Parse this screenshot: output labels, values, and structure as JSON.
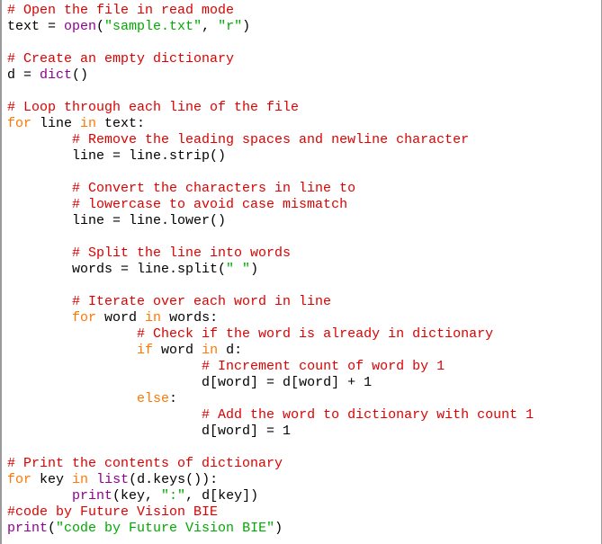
{
  "editor": {
    "indent_unit": "        ",
    "lines": [
      [
        {
          "t": "comment",
          "v": "# Open the file in read mode"
        }
      ],
      [
        {
          "t": "plain",
          "v": "text = "
        },
        {
          "t": "builtin",
          "v": "open"
        },
        {
          "t": "plain",
          "v": "("
        },
        {
          "t": "string",
          "v": "\"sample.txt\""
        },
        {
          "t": "plain",
          "v": ", "
        },
        {
          "t": "string",
          "v": "\"r\""
        },
        {
          "t": "plain",
          "v": ")"
        }
      ],
      [],
      [
        {
          "t": "comment",
          "v": "# Create an empty dictionary"
        }
      ],
      [
        {
          "t": "plain",
          "v": "d = "
        },
        {
          "t": "builtin",
          "v": "dict"
        },
        {
          "t": "plain",
          "v": "()"
        }
      ],
      [],
      [
        {
          "t": "comment",
          "v": "# Loop through each line of the file"
        }
      ],
      [
        {
          "t": "keyword",
          "v": "for"
        },
        {
          "t": "plain",
          "v": " line "
        },
        {
          "t": "keyword",
          "v": "in"
        },
        {
          "t": "plain",
          "v": " text:"
        }
      ],
      [
        {
          "t": "indent",
          "n": 1
        },
        {
          "t": "comment",
          "v": "# Remove the leading spaces and newline character"
        }
      ],
      [
        {
          "t": "indent",
          "n": 1
        },
        {
          "t": "plain",
          "v": "line = line.strip()"
        }
      ],
      [],
      [
        {
          "t": "indent",
          "n": 1
        },
        {
          "t": "comment",
          "v": "# Convert the characters in line to"
        }
      ],
      [
        {
          "t": "indent",
          "n": 1
        },
        {
          "t": "comment",
          "v": "# lowercase to avoid case mismatch"
        }
      ],
      [
        {
          "t": "indent",
          "n": 1
        },
        {
          "t": "plain",
          "v": "line = line.lower()"
        }
      ],
      [],
      [
        {
          "t": "indent",
          "n": 1
        },
        {
          "t": "comment",
          "v": "# Split the line into words"
        }
      ],
      [
        {
          "t": "indent",
          "n": 1
        },
        {
          "t": "plain",
          "v": "words = line.split("
        },
        {
          "t": "string",
          "v": "\" \""
        },
        {
          "t": "plain",
          "v": ")"
        }
      ],
      [],
      [
        {
          "t": "indent",
          "n": 1
        },
        {
          "t": "comment",
          "v": "# Iterate over each word in line"
        }
      ],
      [
        {
          "t": "indent",
          "n": 1
        },
        {
          "t": "keyword",
          "v": "for"
        },
        {
          "t": "plain",
          "v": " word "
        },
        {
          "t": "keyword",
          "v": "in"
        },
        {
          "t": "plain",
          "v": " words:"
        }
      ],
      [
        {
          "t": "indent",
          "n": 2
        },
        {
          "t": "comment",
          "v": "# Check if the word is already in dictionary"
        }
      ],
      [
        {
          "t": "indent",
          "n": 2
        },
        {
          "t": "keyword",
          "v": "if"
        },
        {
          "t": "plain",
          "v": " word "
        },
        {
          "t": "keyword",
          "v": "in"
        },
        {
          "t": "plain",
          "v": " d:"
        }
      ],
      [
        {
          "t": "indent",
          "n": 3
        },
        {
          "t": "comment",
          "v": "# Increment count of word by 1"
        }
      ],
      [
        {
          "t": "indent",
          "n": 3
        },
        {
          "t": "plain",
          "v": "d[word] = d[word] + 1"
        }
      ],
      [
        {
          "t": "indent",
          "n": 2
        },
        {
          "t": "keyword",
          "v": "else"
        },
        {
          "t": "plain",
          "v": ":"
        }
      ],
      [
        {
          "t": "indent",
          "n": 3
        },
        {
          "t": "comment",
          "v": "# Add the word to dictionary with count 1"
        }
      ],
      [
        {
          "t": "indent",
          "n": 3
        },
        {
          "t": "plain",
          "v": "d[word] = 1"
        }
      ],
      [],
      [
        {
          "t": "comment",
          "v": "# Print the contents of dictionary"
        }
      ],
      [
        {
          "t": "keyword",
          "v": "for"
        },
        {
          "t": "plain",
          "v": " key "
        },
        {
          "t": "keyword",
          "v": "in"
        },
        {
          "t": "plain",
          "v": " "
        },
        {
          "t": "builtin",
          "v": "list"
        },
        {
          "t": "plain",
          "v": "(d.keys()):"
        }
      ],
      [
        {
          "t": "indent",
          "n": 1
        },
        {
          "t": "builtin",
          "v": "print"
        },
        {
          "t": "plain",
          "v": "(key, "
        },
        {
          "t": "string",
          "v": "\":\""
        },
        {
          "t": "plain",
          "v": ", d[key])"
        }
      ],
      [
        {
          "t": "comment",
          "v": "#code by Future Vision BIE"
        }
      ],
      [
        {
          "t": "builtin",
          "v": "print"
        },
        {
          "t": "plain",
          "v": "("
        },
        {
          "t": "string",
          "v": "\"code by Future Vision BIE\""
        },
        {
          "t": "plain",
          "v": ")"
        }
      ]
    ]
  }
}
